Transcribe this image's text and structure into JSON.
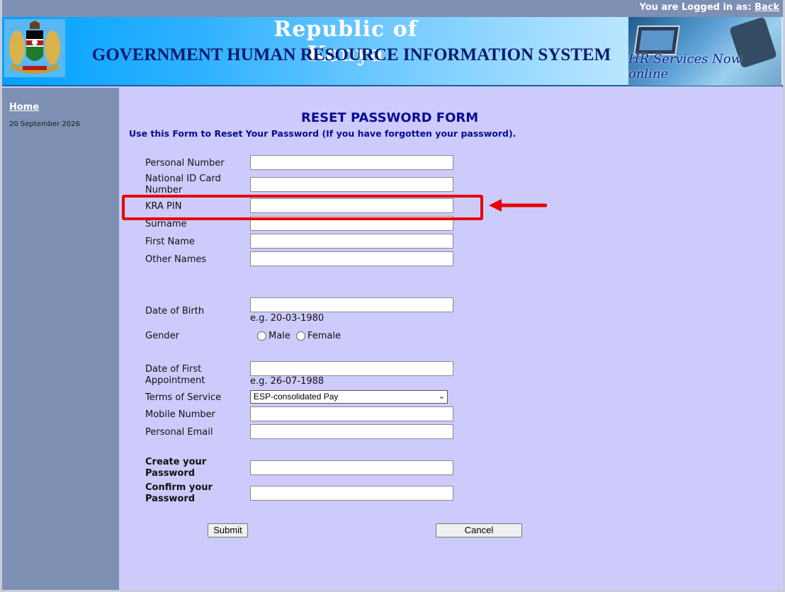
{
  "topbar": {
    "logged_in_text": "You are Logged in as:",
    "back_link": "Back"
  },
  "banner": {
    "title": "Republic of Kenya",
    "subtitle": "GOVERNMENT HUMAN RESOURCE INFORMATION SYSTEM",
    "image_caption": "HR Services Now online"
  },
  "sidebar": {
    "home_link": "Home",
    "date": "20 September 2026"
  },
  "form": {
    "title": "RESET PASSWORD FORM",
    "subtitle": "Use this Form to Reset Your Password (If you have forgotten your password).",
    "fields": {
      "personal_number": {
        "label": "Personal Number",
        "value": ""
      },
      "national_id": {
        "label": "National ID Card Number",
        "value": ""
      },
      "kra_pin": {
        "label": "KRA PIN",
        "value": ""
      },
      "surname": {
        "label": "Surname",
        "value": ""
      },
      "first_name": {
        "label": "First Name",
        "value": ""
      },
      "other_names": {
        "label": "Other Names",
        "value": ""
      },
      "date_of_birth": {
        "label": "Date of Birth",
        "value": "",
        "hint": "e.g. 20-03-1980"
      },
      "gender": {
        "label": "Gender",
        "options": [
          "Male",
          "Female"
        ]
      },
      "date_first_appointment": {
        "label": "Date of First Appointment",
        "value": "",
        "hint": "e.g. 26-07-1988"
      },
      "terms_of_service": {
        "label": "Terms of Service",
        "selected": "ESP-consolidated Pay"
      },
      "mobile_number": {
        "label": "Mobile Number",
        "value": ""
      },
      "personal_email": {
        "label": "Personal Email",
        "value": ""
      },
      "create_password": {
        "label": "Create your Password",
        "value": ""
      },
      "confirm_password": {
        "label": "Confirm your Password",
        "value": ""
      }
    },
    "submit_label": "Submit",
    "cancel_label": "Cancel"
  },
  "annotation": {
    "color": "#e60000"
  }
}
